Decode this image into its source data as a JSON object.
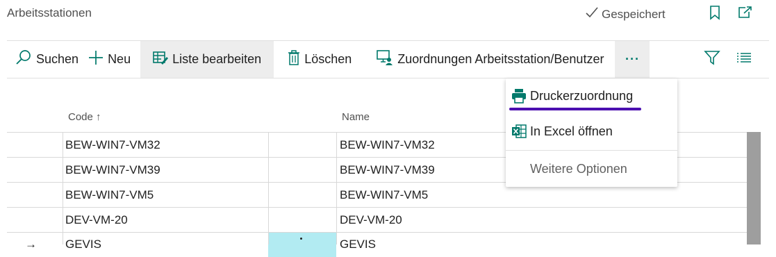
{
  "header": {
    "title": "Arbeitsstationen",
    "saved_label": "Gespeichert"
  },
  "toolbar": {
    "search_label": "Suchen",
    "new_label": "Neu",
    "edit_list_label": "Liste bearbeiten",
    "delete_label": "Löschen",
    "assignments_label": "Zuordnungen Arbeitsstation/Benutzer",
    "more_label": "···"
  },
  "menu": {
    "printer_label": "Druckerzuordnung",
    "excel_label": "In Excel öffnen",
    "more_options_label": "Weitere Optionen"
  },
  "table": {
    "code_header": "Code",
    "sort_indicator": "↑",
    "name_header": "Name",
    "rows": [
      {
        "code": "BEW-WIN7-VM32",
        "name": "BEW-WIN7-VM32"
      },
      {
        "code": "BEW-WIN7-VM39",
        "name": "BEW-WIN7-VM39"
      },
      {
        "code": "BEW-WIN7-VM5",
        "name": "BEW-WIN7-VM5"
      },
      {
        "code": "DEV-VM-20",
        "name": "DEV-VM-20"
      },
      {
        "code": "GEVIS",
        "name": "GEVIS"
      }
    ],
    "current_row_marker": "→"
  },
  "colors": {
    "accent": "#00796b",
    "focus_underline": "#4b0fb0",
    "selected_cell": "#b2ebf2"
  }
}
